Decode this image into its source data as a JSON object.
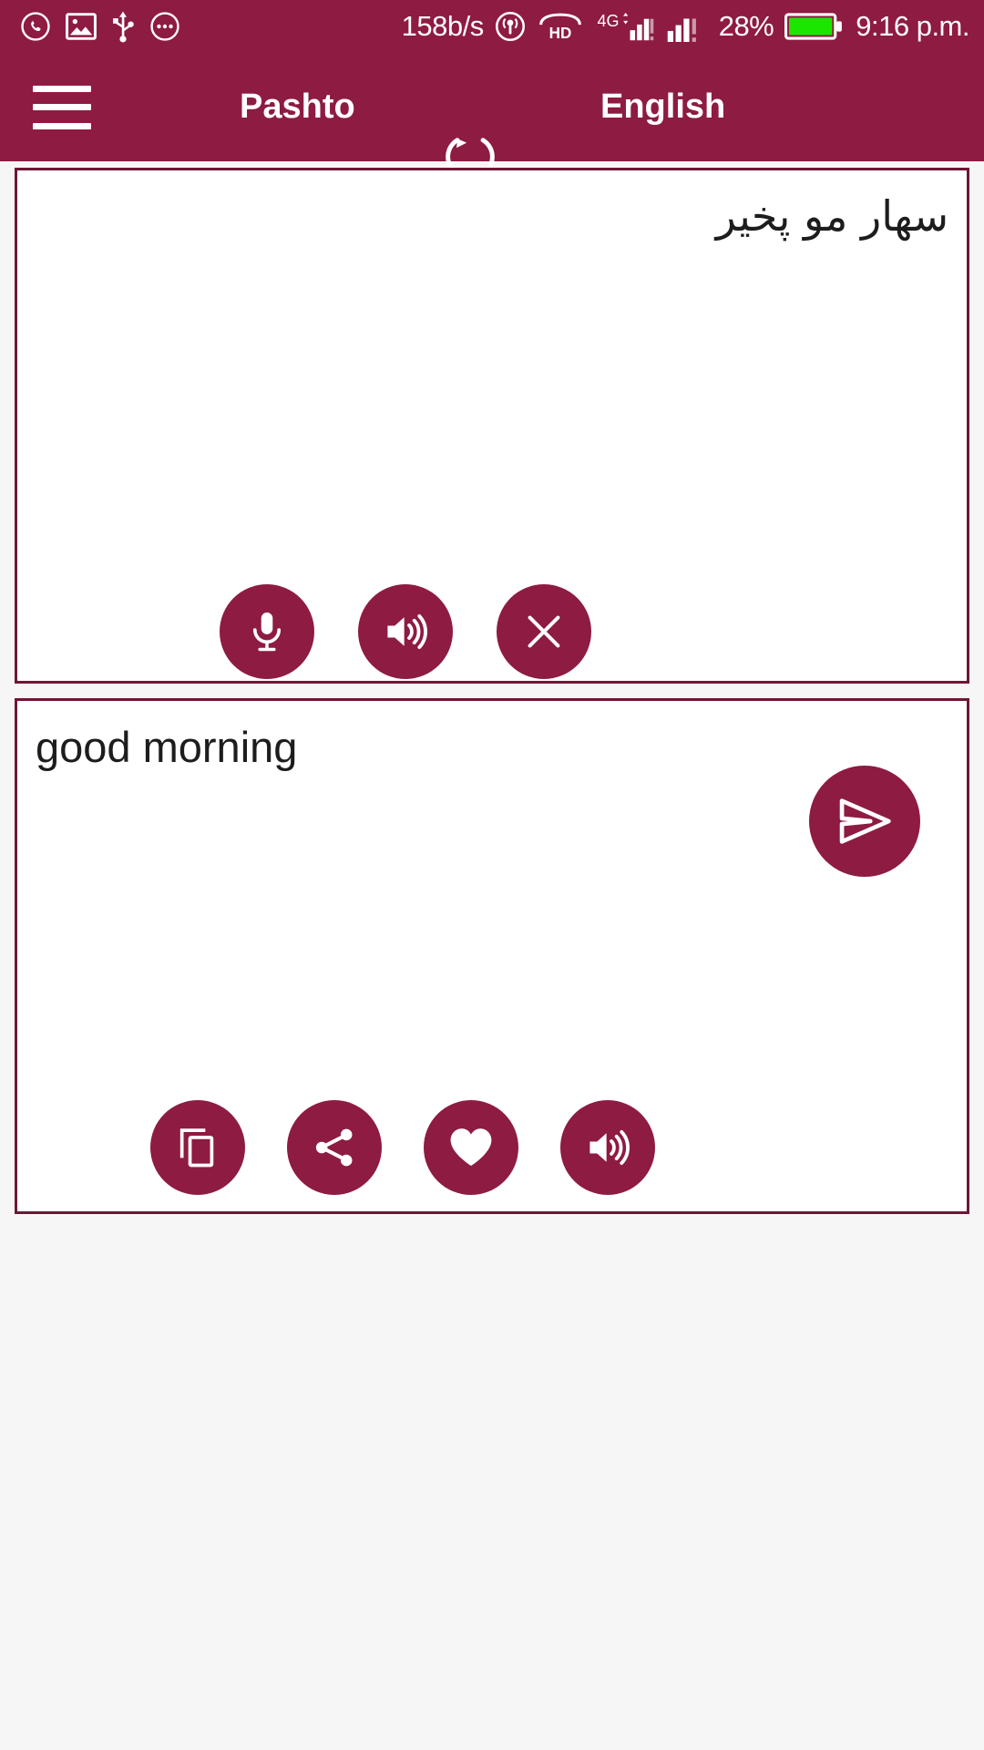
{
  "status_bar": {
    "background": "#8e1b41",
    "left_icons": [
      {
        "name": "whatsapp-icon",
        "label": "WhatsApp"
      },
      {
        "name": "image-icon",
        "label": "Screenshot"
      },
      {
        "name": "usb-icon",
        "label": "USB"
      },
      {
        "name": "more-icon",
        "label": "More notifications"
      }
    ],
    "network_speed": "158b/s",
    "hotspot_icon": "hotspot-icon",
    "volte_label": "HD",
    "network_type": "4G",
    "signal_1_icon": "signal-bars-icon",
    "signal_2_icon": "signal-bars-icon",
    "battery_percent": "28%",
    "battery_color": "#1ae600",
    "clock": "9:16 p.m."
  },
  "app_bar": {
    "background": "#8e1b41",
    "menu_icon": "hamburger-menu-icon",
    "source_language": "Pashto",
    "swap_icon": "swap-languages-icon",
    "target_language": "English"
  },
  "source_panel": {
    "text": "سهار مو پخير",
    "direction": "rtl",
    "actions": [
      {
        "name": "microphone-button",
        "icon": "microphone-icon",
        "label": "Voice input"
      },
      {
        "name": "speak-source-button",
        "icon": "speaker-icon",
        "label": "Speak"
      },
      {
        "name": "clear-text-button",
        "icon": "close-x-icon",
        "label": "Clear"
      }
    ]
  },
  "send_button": {
    "name": "translate-send-button",
    "icon": "send-paper-plane-icon",
    "label": "Translate",
    "color": "#8e1b41"
  },
  "target_panel": {
    "text": "good morning",
    "direction": "ltr",
    "actions": [
      {
        "name": "copy-button",
        "icon": "copy-icon",
        "label": "Copy"
      },
      {
        "name": "share-button",
        "icon": "share-icon",
        "label": "Share"
      },
      {
        "name": "favorite-button",
        "icon": "heart-icon",
        "label": "Favorite"
      },
      {
        "name": "speak-target-button",
        "icon": "speaker-icon",
        "label": "Speak"
      }
    ]
  },
  "theme": {
    "accent": "#8e1b41",
    "border": "#6e1634",
    "panel_background": "#ffffff",
    "page_background": "#f7f6f7",
    "text_color": "#1d1d1d"
  }
}
